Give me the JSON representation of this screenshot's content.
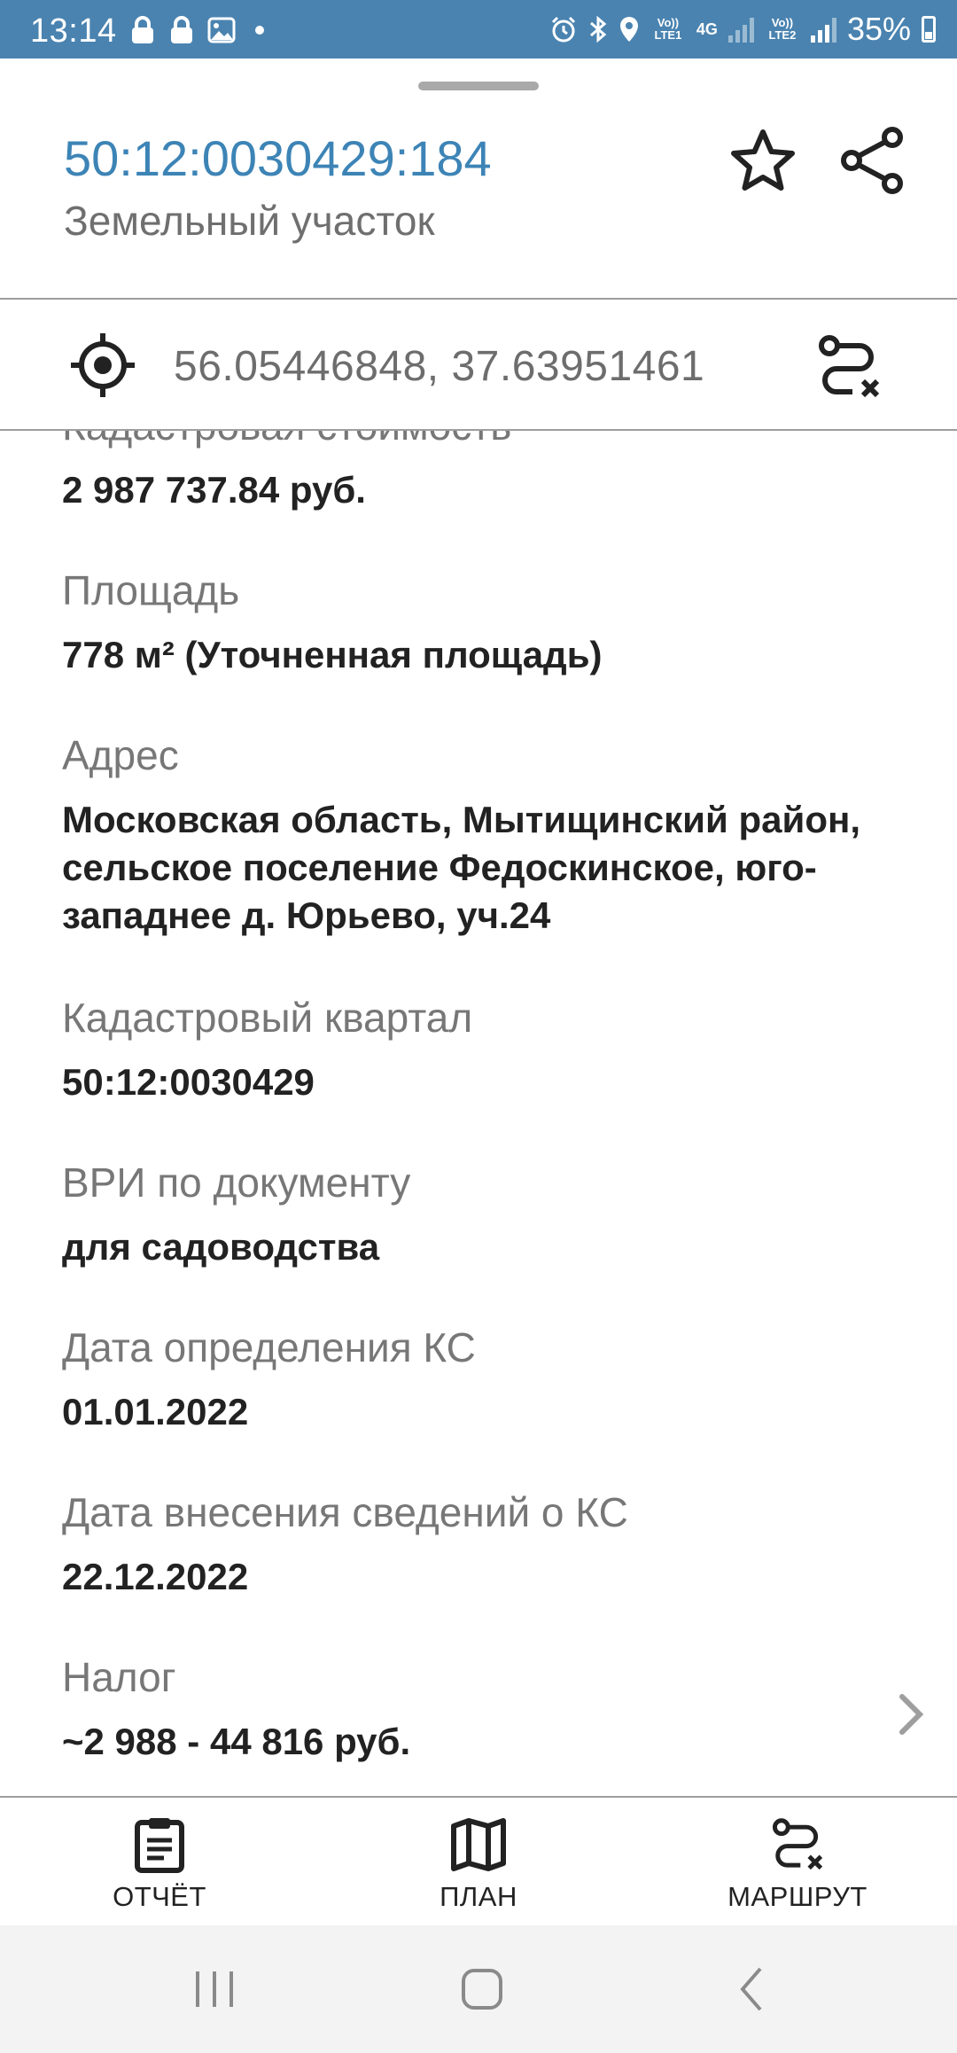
{
  "status_bar": {
    "time": "13:14",
    "battery": "35%",
    "sim1": "Vo)) LTE1",
    "sim2": "Vo)) LTE2",
    "net": "4G",
    "left_icons": [
      "lock-icon",
      "lock-icon",
      "image-icon",
      "dot"
    ],
    "right_icons": [
      "alarm-icon",
      "bluetooth-icon",
      "location-icon"
    ]
  },
  "header": {
    "title": "50:12:0030429:184",
    "subtitle": "Земельный участок"
  },
  "coords": {
    "value": "56.05446848, 37.63951461"
  },
  "details": [
    {
      "label": "Кадастровая стоимость",
      "value": "2 987 737.84 руб."
    },
    {
      "label": "Площадь",
      "value": "778 м² (Уточненная площадь)"
    },
    {
      "label": "Адрес",
      "value": "Московская область, Мытищинский район, сельское поселение Федоскинское, юго-западнее д. Юрьево, уч.24"
    },
    {
      "label": "Кадастровый квартал",
      "value": "50:12:0030429"
    },
    {
      "label": "ВРИ по документу",
      "value": "для садоводства"
    },
    {
      "label": "Дата определения КС",
      "value": "01.01.2022"
    },
    {
      "label": "Дата внесения сведений о КС",
      "value": "22.12.2022"
    },
    {
      "label": "Налог",
      "value": "~2 988 - 44 816 руб."
    }
  ],
  "bottom_nav": [
    {
      "label": "ОТЧЁТ",
      "icon": "clipboard-icon"
    },
    {
      "label": "ПЛАН",
      "icon": "map-icon"
    },
    {
      "label": "МАРШРУТ",
      "icon": "route-icon"
    }
  ],
  "colors": {
    "status_bar": "#4a83b0",
    "title": "#3d84b6",
    "label": "#777777",
    "value": "#222222"
  }
}
